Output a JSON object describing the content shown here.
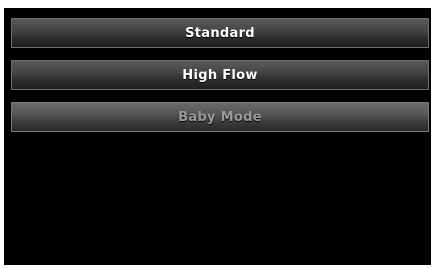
{
  "modes": [
    {
      "label": "Standard",
      "enabled": true
    },
    {
      "label": "High Flow",
      "enabled": true
    },
    {
      "label": "Baby Mode",
      "enabled": false
    }
  ],
  "colors": {
    "background": "#000000",
    "button_text": "#ffffff",
    "button_text_disabled": "#9a9a9a"
  }
}
